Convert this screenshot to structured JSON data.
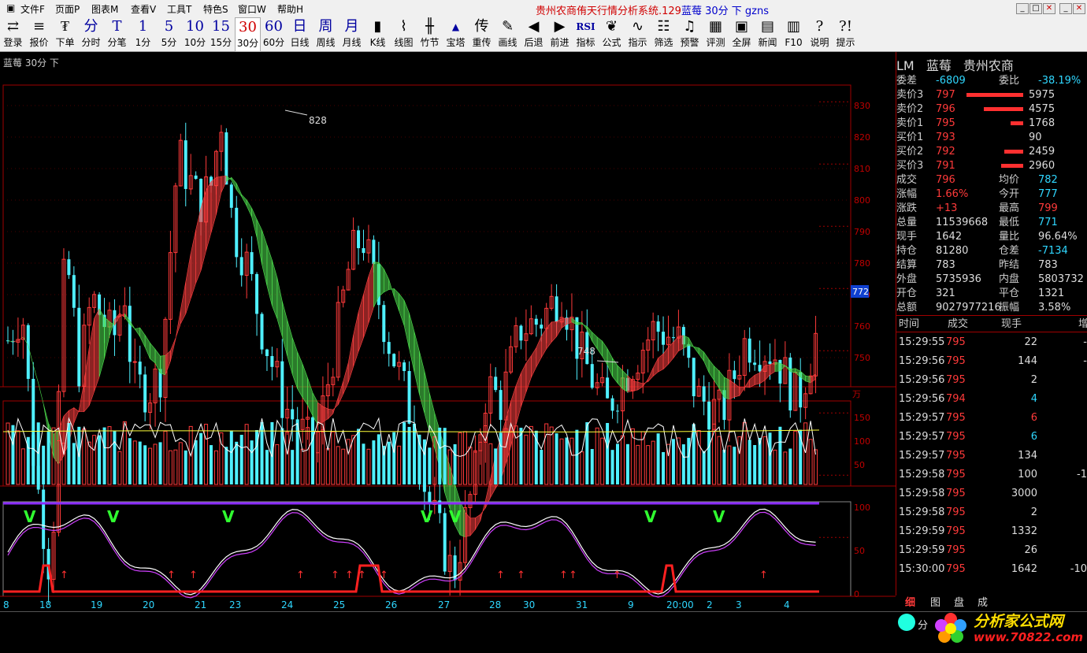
{
  "menu": {
    "items": [
      "文件F",
      "页面P",
      "图表M",
      "查看V",
      "工具T",
      "特色S",
      "窗口W",
      "帮助H"
    ],
    "title_a": "贵州农商侑天行情分析系统.129",
    "title_b": "蓝莓 30分 下 gzns"
  },
  "toolbar": [
    {
      "icon": "⇄",
      "label": "登录"
    },
    {
      "icon": "≡",
      "label": "报价"
    },
    {
      "icon": "₮",
      "label": "下单"
    },
    {
      "icon": "分",
      "label": "分时"
    },
    {
      "icon": "T",
      "label": "分笔"
    },
    {
      "icon": "1",
      "label": "1分"
    },
    {
      "icon": "5",
      "label": "5分"
    },
    {
      "icon": "10",
      "label": "10分"
    },
    {
      "icon": "15",
      "label": "15分"
    },
    {
      "icon": "30",
      "label": "30分"
    },
    {
      "icon": "60",
      "label": "60分"
    },
    {
      "icon": "日",
      "label": "日线"
    },
    {
      "icon": "周",
      "label": "周线"
    },
    {
      "icon": "月",
      "label": "月线"
    },
    {
      "icon": "▮",
      "label": "K线"
    },
    {
      "icon": "⌇",
      "label": "线图"
    },
    {
      "icon": "╫",
      "label": "竹节"
    },
    {
      "icon": "▲",
      "label": "宝塔"
    },
    {
      "icon": "传",
      "label": "重传"
    },
    {
      "icon": "✎",
      "label": "画线"
    },
    {
      "icon": "◀",
      "label": "后退"
    },
    {
      "icon": "▶",
      "label": "前进"
    },
    {
      "icon": "RSI",
      "label": "指标"
    },
    {
      "icon": "❦",
      "label": "公式"
    },
    {
      "icon": "∿",
      "label": "指示"
    },
    {
      "icon": "☷",
      "label": "筛选"
    },
    {
      "icon": "♫",
      "label": "预警"
    },
    {
      "icon": "▦",
      "label": "评测"
    },
    {
      "icon": "▣",
      "label": "全屏"
    },
    {
      "icon": "▤",
      "label": "新闻"
    },
    {
      "icon": "▥",
      "label": "F10"
    },
    {
      "icon": "?",
      "label": "说明"
    },
    {
      "icon": "?!",
      "label": "提示"
    }
  ],
  "chart_header": "蓝莓 30分 下",
  "chart": {
    "price_ticks": [
      "830",
      "820",
      "810",
      "800",
      "790",
      "780",
      "770",
      "760",
      "750"
    ],
    "high_label": "828",
    "low_label": "748",
    "current_price_tag": "772",
    "vol_unit": "万",
    "vol_ticks": [
      "150",
      "100",
      "50"
    ],
    "osc_ticks": [
      "100",
      "50",
      "0"
    ],
    "date_labels": [
      "8",
      "18",
      "19",
      "20",
      "21",
      "23",
      "24",
      "25",
      "26",
      "27",
      "28",
      "30",
      "31",
      "9",
      "20:00",
      "2",
      "3",
      "4"
    ],
    "colors": {
      "up": "#ff3a3a",
      "down": "#4ff0ff",
      "ma_up": "#ff4040",
      "ma_down": "#4ee04e",
      "grid": "#a00000",
      "osc_line": "#ffffff",
      "osc_line2": "#d040ff",
      "signal": "#ff2020",
      "purple_line": "#8a2bff"
    }
  },
  "quote": {
    "header": [
      "LM",
      "蓝莓",
      "贵州农商"
    ],
    "rows": [
      {
        "k": "委差",
        "v": "-6809",
        "vc": "cy",
        "k2": "委比",
        "v2": "-38.19%",
        "v2c": "cy"
      },
      {
        "k": "卖价3",
        "v": "797",
        "vc": "red",
        "vol": "5975",
        "bar": 0.9
      },
      {
        "k": "卖价2",
        "v": "796",
        "vc": "red",
        "vol": "4575",
        "bar": 0.63
      },
      {
        "k": "卖价1",
        "v": "795",
        "vc": "red",
        "vol": "1768",
        "bar": 0.2
      },
      {
        "k": "买价1",
        "v": "793",
        "vc": "red",
        "vol": "90",
        "bar": 0
      },
      {
        "k": "买价2",
        "v": "792",
        "vc": "red",
        "vol": "2459",
        "bar": 0.3
      },
      {
        "k": "买价3",
        "v": "791",
        "vc": "red",
        "vol": "2960",
        "bar": 0.35
      },
      {
        "k": "成交",
        "v": "796",
        "vc": "red",
        "k2": "均价",
        "v2": "782",
        "v2c": "cy"
      },
      {
        "k": "涨幅",
        "v": "1.66%",
        "vc": "red",
        "k2": "今开",
        "v2": "777",
        "v2c": "cy"
      },
      {
        "k": "涨跌",
        "v": "+13",
        "vc": "red",
        "k2": "最高",
        "v2": "799",
        "v2c": "red"
      },
      {
        "k": "总量",
        "v": "11539668",
        "vc": "wht",
        "k2": "最低",
        "v2": "771",
        "v2c": "cy"
      },
      {
        "k": "现手",
        "v": "1642",
        "vc": "wht",
        "k2": "量比",
        "v2": "96.64%",
        "v2c": "wht"
      },
      {
        "k": "持仓",
        "v": "81280",
        "vc": "wht",
        "k2": "仓差",
        "v2": "-7134",
        "v2c": "cy"
      },
      {
        "k": "结算",
        "v": "783",
        "vc": "wht",
        "k2": "昨结",
        "v2": "783",
        "v2c": "wht"
      },
      {
        "k": "外盘",
        "v": "5735936",
        "vc": "wht",
        "k2": "内盘",
        "v2": "5803732",
        "v2c": "wht"
      },
      {
        "k": "开仓",
        "v": "321",
        "vc": "wht",
        "k2": "平仓",
        "v2": "1321",
        "v2c": "wht"
      },
      {
        "k": "总额",
        "v": "9027977216",
        "vc": "wht",
        "k2": "振幅",
        "v2": "3.58%",
        "v2c": "wht"
      }
    ]
  },
  "ticks": {
    "headers": [
      "时间",
      "成交",
      "现手",
      "增"
    ],
    "rows": [
      {
        "t": "15:29:55",
        "p": "795",
        "n": "22",
        "nc": "wht",
        "e": "-"
      },
      {
        "t": "15:29:56",
        "p": "795",
        "n": "144",
        "nc": "wht",
        "e": "-"
      },
      {
        "t": "15:29:56",
        "p": "795",
        "n": "2",
        "nc": "wht",
        "e": ""
      },
      {
        "t": "15:29:56",
        "p": "794",
        "n": "4",
        "nc": "cy",
        "e": ""
      },
      {
        "t": "15:29:57",
        "p": "795",
        "n": "6",
        "nc": "red",
        "e": ""
      },
      {
        "t": "15:29:57",
        "p": "795",
        "n": "6",
        "nc": "cy",
        "e": ""
      },
      {
        "t": "15:29:57",
        "p": "795",
        "n": "134",
        "nc": "wht",
        "e": ""
      },
      {
        "t": "15:29:58",
        "p": "795",
        "n": "100",
        "nc": "wht",
        "e": "-1"
      },
      {
        "t": "15:29:58",
        "p": "795",
        "n": "3000",
        "nc": "wht",
        "e": ""
      },
      {
        "t": "15:29:58",
        "p": "795",
        "n": "2",
        "nc": "wht",
        "e": ""
      },
      {
        "t": "15:29:59",
        "p": "795",
        "n": "1332",
        "nc": "wht",
        "e": ""
      },
      {
        "t": "15:29:59",
        "p": "795",
        "n": "26",
        "nc": "wht",
        "e": ""
      },
      {
        "t": "15:30:00",
        "p": "795",
        "n": "1642",
        "nc": "wht",
        "e": "-10"
      }
    ]
  },
  "bottom_tabs": [
    "细",
    "图",
    "盘",
    "成"
  ],
  "bottom": {
    "fen": "分",
    "logo": "分析家公式网",
    "url": "www.70822.com"
  }
}
